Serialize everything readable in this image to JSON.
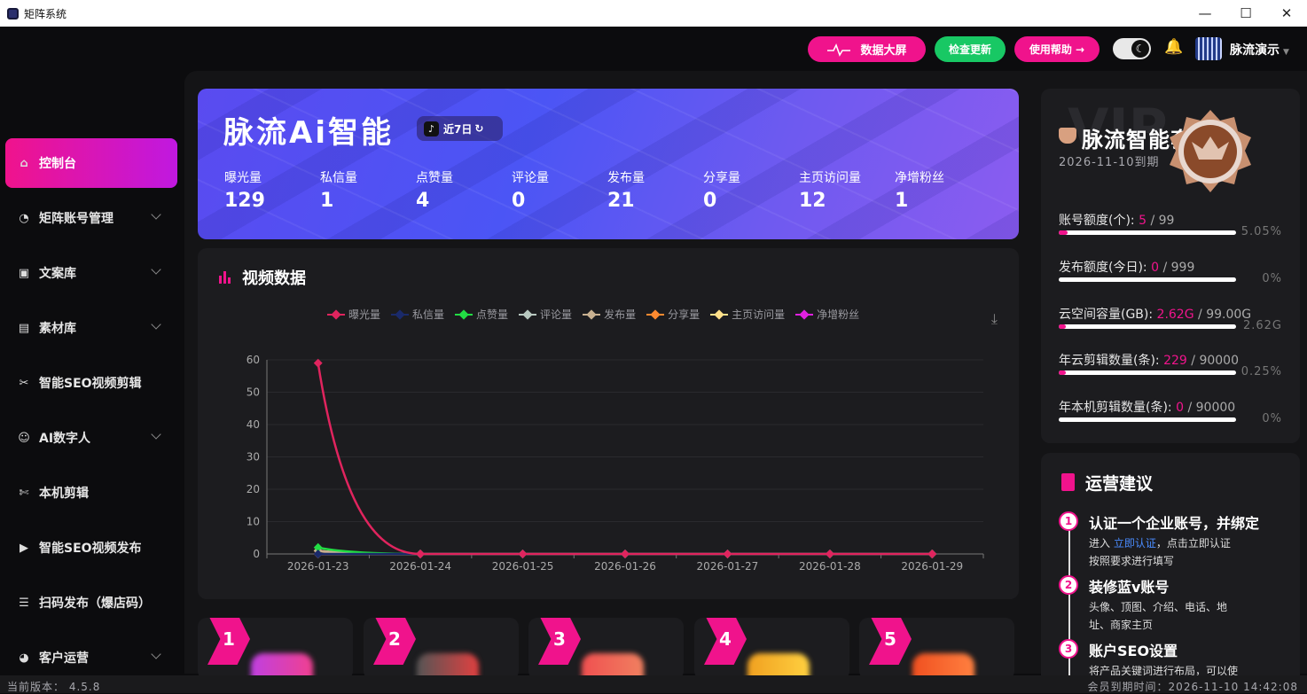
{
  "window": {
    "title": "矩阵系统",
    "min": "—",
    "max": "☐",
    "close": "✕"
  },
  "topbar": {
    "screen_btn": "数据大屏",
    "update_btn": "检查更新",
    "help_btn": "使用帮助 →",
    "user_name": "脉流演示"
  },
  "sidebar": {
    "items": [
      {
        "label": "控制台",
        "icon": "home-icon"
      },
      {
        "label": "矩阵账号管理",
        "icon": "dashboard-icon"
      },
      {
        "label": "文案库",
        "icon": "document-icon"
      },
      {
        "label": "素材库",
        "icon": "folder-icon"
      },
      {
        "label": "智能SEO视频剪辑",
        "icon": "scissors-icon"
      },
      {
        "label": "AI数字人",
        "icon": "avatar-icon"
      },
      {
        "label": "本机剪辑",
        "icon": "scissors-icon"
      },
      {
        "label": "智能SEO视频发布",
        "icon": "video-icon"
      },
      {
        "label": "扫码发布（爆店码）",
        "icon": "qr-icon"
      },
      {
        "label": "客户运营",
        "icon": "customer-icon"
      }
    ]
  },
  "hero": {
    "brand": "脉流Ai智能",
    "period": "近7日",
    "stats": [
      {
        "label": "曝光量",
        "value": "129"
      },
      {
        "label": "私信量",
        "value": "1"
      },
      {
        "label": "点赞量",
        "value": "4"
      },
      {
        "label": "评论量",
        "value": "0"
      },
      {
        "label": "发布量",
        "value": "21"
      },
      {
        "label": "分享量",
        "value": "0"
      },
      {
        "label": "主页访问量",
        "value": "12"
      },
      {
        "label": "净增粉丝",
        "value": "1"
      }
    ]
  },
  "chart_data": {
    "type": "line",
    "title": "视频数据",
    "categories": [
      "2026-01-23",
      "2026-01-24",
      "2026-01-25",
      "2026-01-26",
      "2026-01-27",
      "2026-01-28",
      "2026-01-29"
    ],
    "ylim": [
      0,
      60
    ],
    "yticks": [
      0,
      10,
      20,
      30,
      40,
      50,
      60
    ],
    "legend_position": "top-center",
    "grid": true,
    "series": [
      {
        "name": "曝光量",
        "color": "#e0245e",
        "values": [
          59,
          0,
          0,
          0,
          0,
          0,
          0
        ]
      },
      {
        "name": "私信量",
        "color": "#1a2a6a",
        "values": [
          0,
          0,
          0,
          0,
          0,
          0,
          0
        ]
      },
      {
        "name": "点赞量",
        "color": "#22dd44",
        "values": [
          2,
          0,
          0,
          0,
          0,
          0,
          0
        ]
      },
      {
        "name": "评论量",
        "color": "#b8c8c0",
        "values": [
          0,
          0,
          0,
          0,
          0,
          0,
          0
        ]
      },
      {
        "name": "发布量",
        "color": "#c8b090",
        "values": [
          1,
          0,
          0,
          0,
          0,
          0,
          0
        ]
      },
      {
        "name": "分享量",
        "color": "#ff8a30",
        "values": [
          0,
          0,
          0,
          0,
          0,
          0,
          0
        ]
      },
      {
        "name": "主页访问量",
        "color": "#ffe08a",
        "values": [
          1,
          0,
          0,
          0,
          0,
          0,
          0
        ]
      },
      {
        "name": "净增粉丝",
        "color": "#e020e0",
        "values": [
          0,
          0,
          0,
          0,
          0,
          0,
          0
        ]
      }
    ]
  },
  "feature_cards": [
    "1",
    "2",
    "3",
    "4",
    "5"
  ],
  "vip": {
    "watermark": "VIP",
    "package": "脉流智能套餐",
    "expires": "2026-11-10到期",
    "quotas": [
      {
        "label": "账号额度(个):",
        "used": "5",
        "total": "99",
        "pct": "5.05%",
        "ratio": 0.0505
      },
      {
        "label": "发布额度(今日):",
        "used": "0",
        "total": "999",
        "pct": "0%",
        "ratio": 0
      },
      {
        "label": "云空间容量(GB):",
        "used": "2.62G",
        "total": "99.00G",
        "pct": "2.62G",
        "ratio": 0.0265
      },
      {
        "label": "年云剪辑数量(条):",
        "used": "229",
        "total": "90000",
        "pct": "0.25%",
        "ratio": 0.0025
      },
      {
        "label": "年本机剪辑数量(条):",
        "used": "0",
        "total": "90000",
        "pct": "0%",
        "ratio": 0
      }
    ]
  },
  "advice": {
    "title": "运营建议",
    "steps": [
      {
        "num": "1",
        "title": "认证一个企业账号，并绑定",
        "pre": "进入 ",
        "link": "立即认证",
        "post": "，点击立即认证",
        "line2": "按照要求进行填写"
      },
      {
        "num": "2",
        "title": "装修蓝v账号",
        "pre": "头像、顶图、介绍、电话、地址、商家主页",
        "link": "",
        "post": "",
        "line2": ""
      },
      {
        "num": "3",
        "title": "账户SEO设置",
        "pre": "将产品关键词进行布局，可以使",
        "link": "",
        "post": "",
        "line2": ""
      }
    ]
  },
  "statusbar": {
    "version": "当前版本： 4.5.8",
    "expiry": "会员到期时间：2026-11-10 14:42:08"
  },
  "colors": {
    "accent": "#f0138c",
    "green": "#18c864",
    "bg": "#141416",
    "card": "#1c1c1f"
  }
}
